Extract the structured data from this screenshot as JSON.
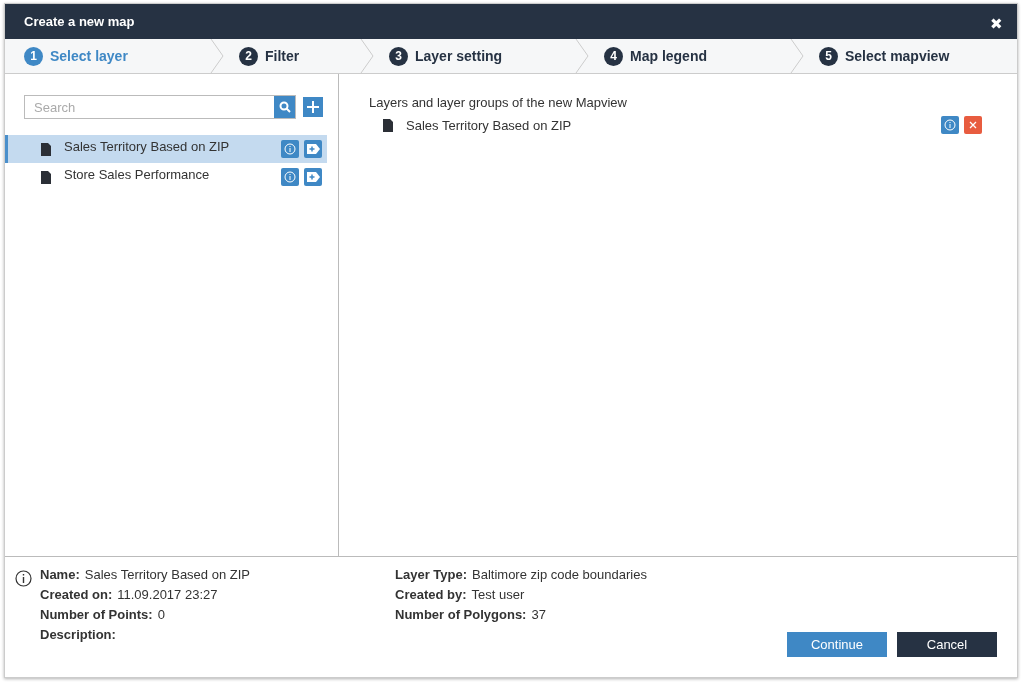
{
  "window": {
    "title": "Create a new map",
    "close": "✖"
  },
  "steps": [
    {
      "number": "1",
      "label": "Select layer",
      "selected": true
    },
    {
      "number": "2",
      "label": "Filter",
      "selected": false
    },
    {
      "number": "3",
      "label": "Layer setting",
      "selected": false
    },
    {
      "number": "4",
      "label": "Map legend",
      "selected": false
    },
    {
      "number": "5",
      "label": "Select mapview",
      "selected": false
    }
  ],
  "search": {
    "placeholder": "Search"
  },
  "layers": [
    {
      "name": "Sales Territory Based on ZIP",
      "selected": true
    },
    {
      "name": "Store Sales Performance",
      "selected": false
    }
  ],
  "mapview": {
    "heading": "Layers and layer groups of the new Mapview",
    "items": [
      {
        "name": "Sales Territory Based on ZIP"
      }
    ]
  },
  "details": {
    "left": [
      {
        "label": "Name:",
        "value": "Sales Territory Based on ZIP"
      },
      {
        "label": "Created on:",
        "value": "11.09.2017 23:27"
      },
      {
        "label": "Number of Points:",
        "value": "0"
      },
      {
        "label": "Description:"
      }
    ],
    "right": [
      {
        "label": "Layer Type:",
        "value": "Baltimore zip code boundaries"
      },
      {
        "label": "Created by:",
        "value": "Test user"
      },
      {
        "label": "Number of Polygons:",
        "value": "37"
      }
    ]
  },
  "buttons": [
    {
      "label": "Continue",
      "kind": "primary"
    },
    {
      "label": "Cancel",
      "kind": "secondary"
    }
  ]
}
